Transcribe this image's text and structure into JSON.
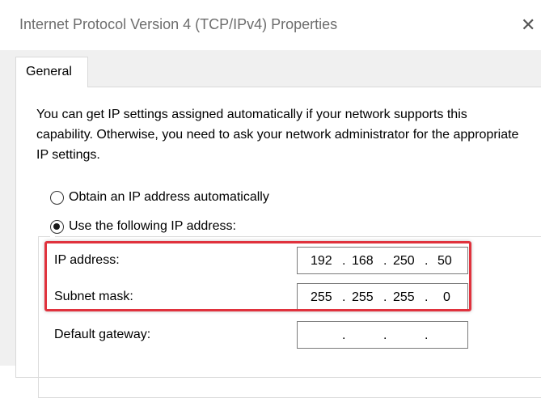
{
  "window": {
    "title": "Internet Protocol Version 4 (TCP/IPv4) Properties",
    "close_glyph": "✕"
  },
  "tabs": [
    {
      "label": "General",
      "selected": true
    }
  ],
  "intro_text": "You can get IP settings assigned automatically if your network supports this capability. Otherwise, you need to ask your network administrator for the appropriate IP settings.",
  "ip_mode": {
    "auto_label": "Obtain an IP address automatically",
    "manual_label": "Use the following IP address:",
    "selected": "manual"
  },
  "fields": {
    "ip_address": {
      "label": "IP address:",
      "octets": [
        "192",
        "168",
        "250",
        "50"
      ]
    },
    "subnet_mask": {
      "label": "Subnet mask:",
      "octets": [
        "255",
        "255",
        "255",
        "0"
      ]
    },
    "default_gateway": {
      "label": "Default gateway:",
      "octets": [
        "",
        "",
        "",
        ""
      ]
    }
  },
  "dot": ".",
  "colors": {
    "highlight_border": "#e0323d",
    "dialog_background": "#f0f0f0",
    "title_text": "#6d6d6d"
  },
  "icons": {
    "close": "close-icon",
    "radio": "radio-button"
  }
}
